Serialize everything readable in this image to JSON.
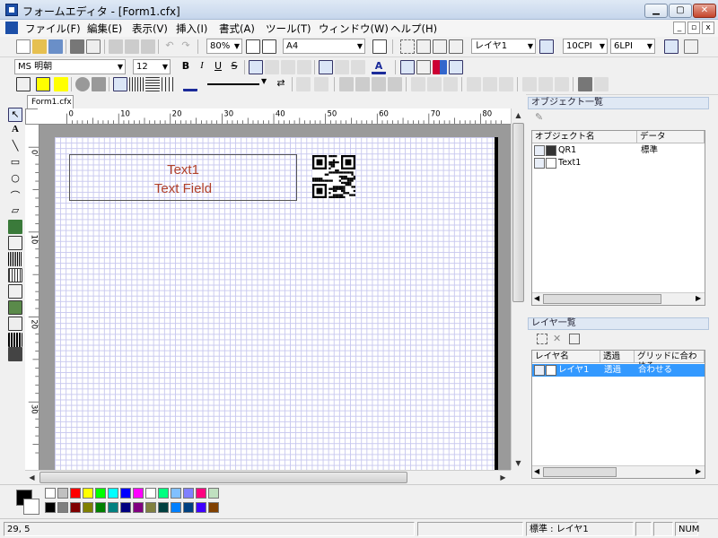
{
  "window": {
    "title": "フォームエディタ - [Form1.cfx]"
  },
  "menu": [
    "ファイル(F)",
    "編集(E)",
    "表示(V)",
    "挿入(I)",
    "書式(A)",
    "ツール(T)",
    "ウィンドウ(W)",
    "ヘルプ(H)"
  ],
  "toolbar1": {
    "zoom": "80%",
    "paper": "A4",
    "layer": "レイヤ1",
    "cpi": "10CPI",
    "lpi": "6LPI"
  },
  "toolbar2": {
    "font": "MS 明朝",
    "size": "12"
  },
  "tab": "Form1.cfx",
  "ruler": {
    "h": [
      "0",
      "10",
      "20",
      "30",
      "40",
      "50",
      "60",
      "70",
      "80"
    ],
    "v": [
      "0",
      "10",
      "20",
      "30"
    ]
  },
  "canvas": {
    "text_line1": "Text1",
    "text_line2": "Text Field"
  },
  "object_panel": {
    "title": "オブジェクト一覧",
    "col_name": "オブジェクト名",
    "col_data": "データ",
    "rows": [
      {
        "name": "QR1",
        "data": "標準"
      },
      {
        "name": "Text1",
        "data": ""
      }
    ]
  },
  "layer_panel": {
    "title": "レイヤ一覧",
    "col_name": "レイヤ名",
    "col_trans": "透過",
    "col_grid": "グリッドに合わせる",
    "rows": [
      {
        "name": "レイヤ1",
        "trans": "透過",
        "grid": "合わせる"
      }
    ]
  },
  "palette": {
    "row1": [
      "#ffffff",
      "#c0c0c0",
      "#ff0000",
      "#ffff00",
      "#00ff00",
      "#00ffff",
      "#0000ff",
      "#ff00ff",
      "#ffffff",
      "#00ff80",
      "#80c0ff",
      "#8080ff",
      "#ff0080",
      "#c0e0c0"
    ],
    "row2": [
      "#000000",
      "#808080",
      "#800000",
      "#808000",
      "#008000",
      "#008080",
      "#000080",
      "#800080",
      "#808040",
      "#004040",
      "#0080ff",
      "#004080",
      "#4000ff",
      "#804000"
    ]
  },
  "status": {
    "pos": "29, 5",
    "layer": "標準 : レイヤ1",
    "num": "NUM"
  }
}
